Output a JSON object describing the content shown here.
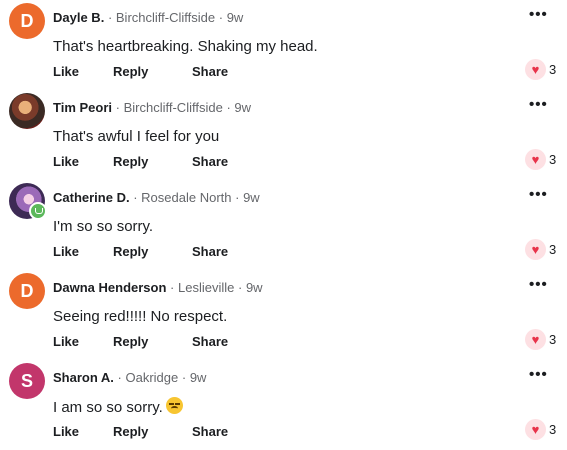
{
  "colors": {
    "avatar_orange": "#ec6a2c",
    "avatar_pink": "#c2366b",
    "heart": "#e8334a"
  },
  "action_labels": {
    "like": "Like",
    "reply": "Reply",
    "share": "Share"
  },
  "more_icon": "more-options-icon",
  "comments": [
    {
      "avatar_initial": "D",
      "avatar_type": "letter",
      "avatar_color": "#ec6a2c",
      "name": "Dayle B.",
      "location": "Birchcliff-Cliffside",
      "time": "9w",
      "text": "That's heartbreaking. Shaking my head.",
      "reaction_count": "3"
    },
    {
      "avatar_initial": "",
      "avatar_type": "photo",
      "name": "Tim Peori",
      "location": "Birchcliff-Cliffside",
      "time": "9w",
      "text": "That's awful I feel for you",
      "reaction_count": "3"
    },
    {
      "avatar_initial": "",
      "avatar_type": "photo",
      "name": "Catherine D.",
      "location": "Rosedale North",
      "time": "9w",
      "text": "I'm so so sorry.",
      "reaction_count": "3"
    },
    {
      "avatar_initial": "D",
      "avatar_type": "letter",
      "avatar_color": "#ec6a2c",
      "name": "Dawna Henderson",
      "location": "Leslieville",
      "time": "9w",
      "text": "Seeing red!!!!! No respect.",
      "reaction_count": "3"
    },
    {
      "avatar_initial": "S",
      "avatar_type": "letter",
      "avatar_color": "#c2366b",
      "name": "Sharon A.",
      "location": "Oakridge",
      "time": "9w",
      "text": "I am so so sorry.",
      "reaction_count": "3"
    }
  ]
}
